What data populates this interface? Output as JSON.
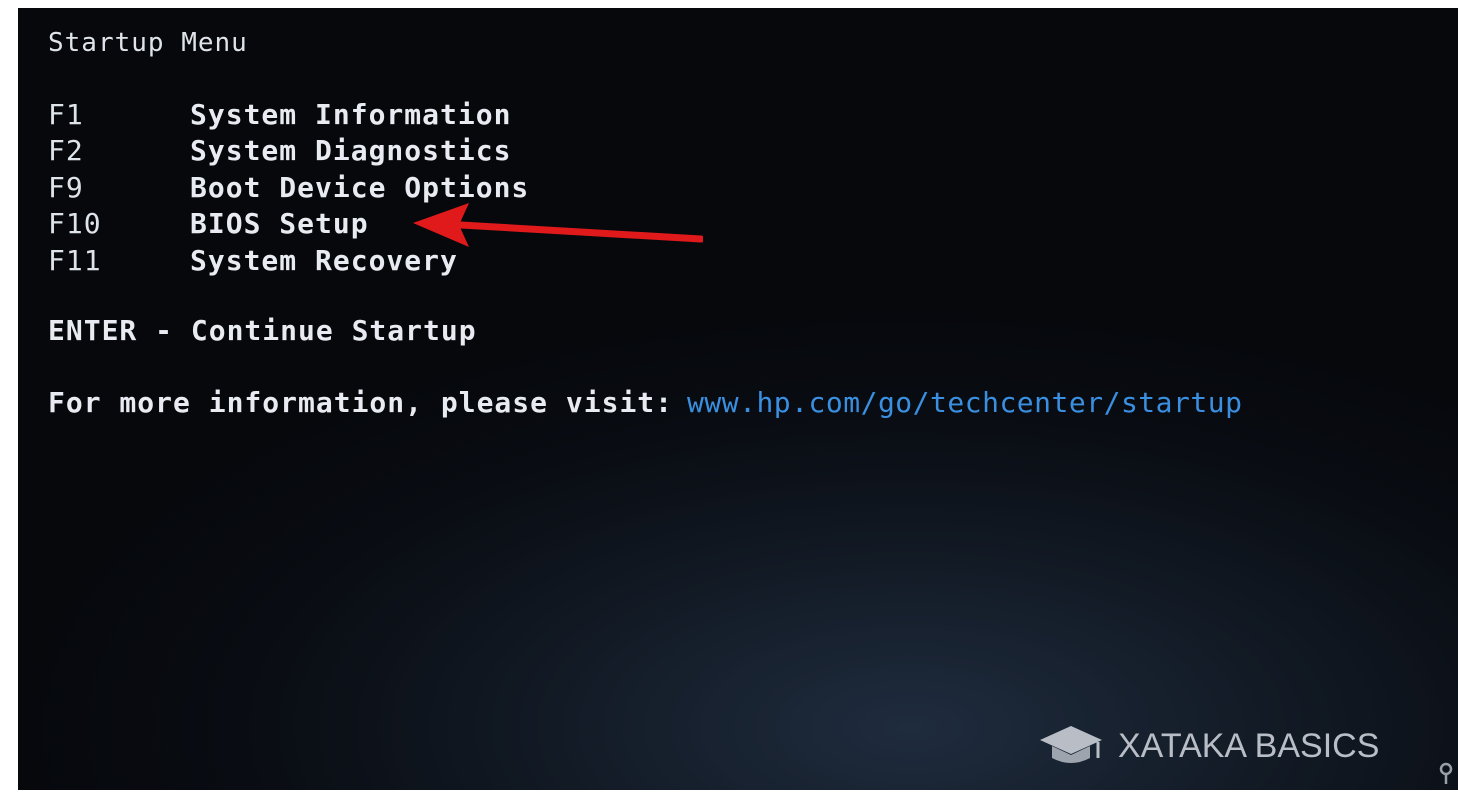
{
  "screen": {
    "title": "Startup Menu",
    "menu": [
      {
        "key": "F1",
        "label": "System Information"
      },
      {
        "key": "F2",
        "label": "System Diagnostics"
      },
      {
        "key": "F9",
        "label": "Boot Device Options"
      },
      {
        "key": "F10",
        "label": "BIOS Setup"
      },
      {
        "key": "F11",
        "label": "System Recovery"
      }
    ],
    "enter_line": "ENTER - Continue Startup",
    "info_text": "For more information, please visit:",
    "info_link": "www.hp.com/go/techcenter/startup"
  },
  "annotation": {
    "arrow_color": "#e0191b",
    "arrow_target": "BIOS Setup"
  },
  "watermark": {
    "text": "XATAKA BASICS",
    "icon": "graduation-cap-icon"
  },
  "colors": {
    "background": "#090c12",
    "text": "#e8ecf2",
    "link": "#3a8fe0"
  }
}
